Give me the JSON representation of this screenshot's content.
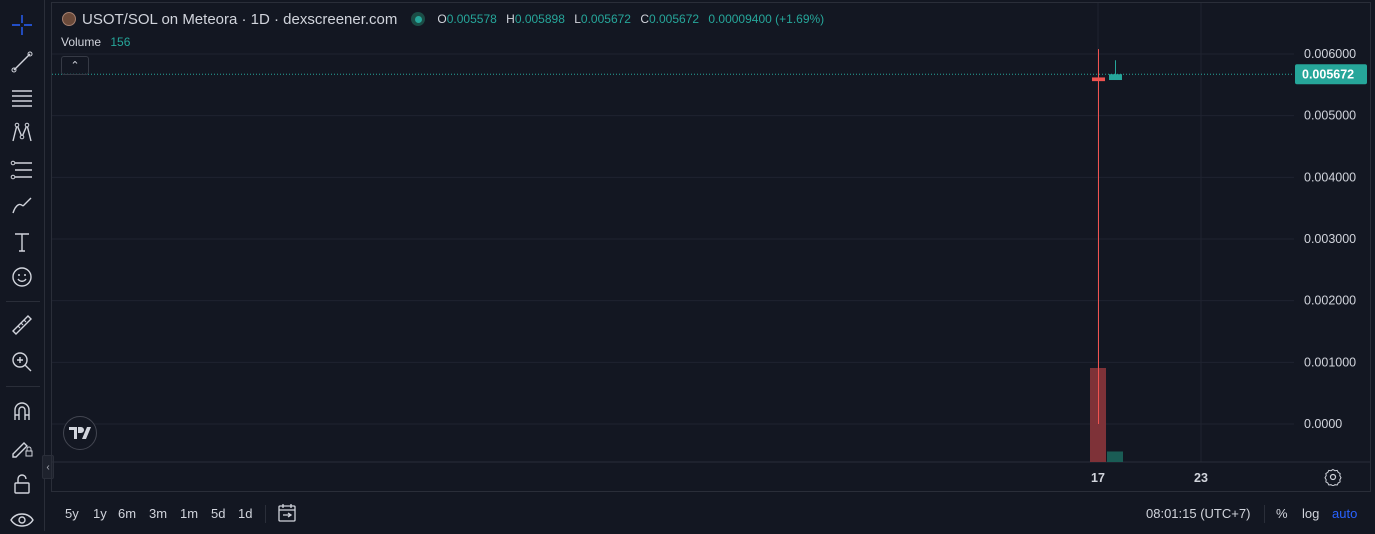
{
  "header": {
    "title": "USOT/SOL on Meteora · 1D · dexscreener.com",
    "ohlc": {
      "o_key": "O",
      "o_val": "0.005578",
      "h_key": "H",
      "h_val": "0.005898",
      "l_key": "L",
      "l_val": "0.005672",
      "c_key": "C",
      "c_val": "0.005672",
      "change": "0.00009400 (+1.69%)"
    },
    "volume_label": "Volume",
    "volume_value": "156",
    "collapse_glyph": "⌃"
  },
  "bottom": {
    "ranges": [
      "5y",
      "1y",
      "6m",
      "3m",
      "1m",
      "5d",
      "1d"
    ],
    "time": "08:01:15 (UTC+7)",
    "percent": "%",
    "log": "log",
    "auto": "auto"
  },
  "colors": {
    "up": "#26a69a",
    "down": "#ef5350",
    "volume_up": "#1a5c55",
    "volume_down": "#7e3238",
    "grid": "#1f2330",
    "text": "#d1d4dc",
    "accent": "#2962ff"
  },
  "toolbar_icons": [
    "crosshair-icon",
    "trend-line-icon",
    "horizontal-lines-icon",
    "pattern-icon",
    "fib-icon",
    "brush-icon",
    "text-icon",
    "emoji-icon",
    "ruler-icon",
    "zoom-in-icon",
    "magnet-icon",
    "pencil-lock-icon",
    "lock-icon",
    "eye-icon"
  ],
  "chart_data": {
    "type": "candlestick",
    "y_ticks": [
      0.0,
      0.001,
      0.002,
      0.003,
      0.004,
      0.005,
      0.006
    ],
    "y_tick_labels": [
      "0.0000",
      "0.001000",
      "0.002000",
      "0.003000",
      "0.004000",
      "0.005000",
      "0.006000"
    ],
    "x_tick_labels": [
      "17",
      "23"
    ],
    "current_price": 0.005672,
    "current_price_label": "0.005672",
    "candles": [
      {
        "x": "17",
        "open": 0.00562,
        "high": 0.00608,
        "low": 0.0,
        "close": 0.00556,
        "volume": 1.25
      },
      {
        "x": "18",
        "open": 0.005578,
        "high": 0.005898,
        "low": 0.005578,
        "close": 0.005672,
        "volume": 0.14
      }
    ],
    "grid": true
  }
}
